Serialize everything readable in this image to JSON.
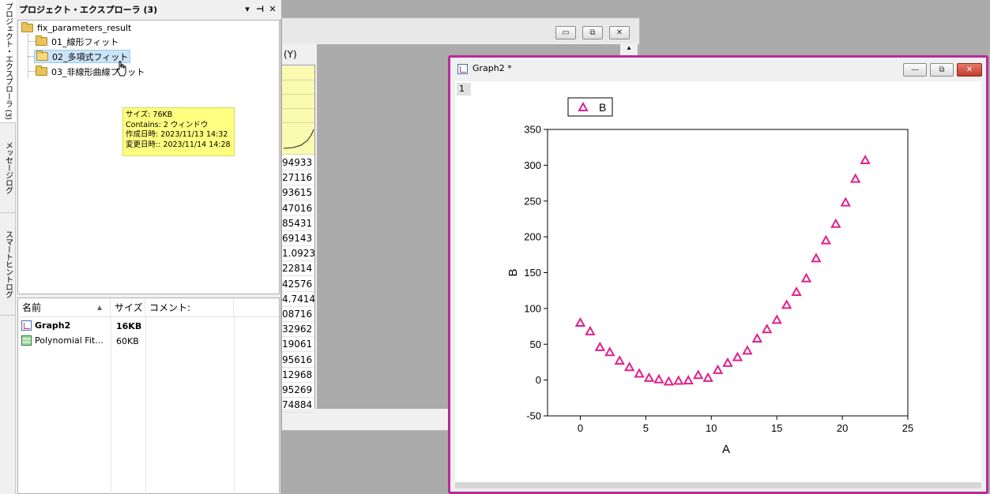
{
  "left_tabs": {
    "project_explorer": "プロジェクト・エクスプローラ (3)",
    "message_log": "メッセージログ",
    "smart_hint_log": "スマートヒントログ"
  },
  "project_explorer": {
    "title": "プロジェクト・エクスプローラ (3)",
    "title_buttons": {
      "dropdown": "▾",
      "pin": "⊣",
      "close": "✕"
    },
    "root": "fix_parameters_result",
    "folders": [
      {
        "label": "01_線形フィット"
      },
      {
        "label": "02_多項式フィット",
        "selected": true
      },
      {
        "label": "03_非線形曲線フィット"
      }
    ],
    "tooltip": {
      "size": "サイズ: 76KB",
      "contains": "Contains: 2 ウィンドウ",
      "created": "作成日時: 2023/11/13 14:32",
      "modified": "変更日時:: 2023/11/14 14:28"
    },
    "list": {
      "headers": {
        "name": "名前",
        "size": "サイズ",
        "comment": "コメント:"
      },
      "rows": [
        {
          "name": "Graph2",
          "size": "16KB",
          "icon": "graph-icon",
          "bold": true
        },
        {
          "name": "Polynomial Fit...",
          "size": "60KB",
          "icon": "workbook-icon",
          "bold": false
        }
      ]
    }
  },
  "workbook": {
    "column_header": "(Y)",
    "values": [
      "94933",
      "27116",
      "93615",
      "47016",
      "85431",
      "69143",
      "1.0923",
      "22814",
      "42576",
      "4.7414",
      "08716",
      "32962",
      "19061",
      "95616",
      "12968",
      "95269",
      "74884"
    ],
    "buttons": {
      "minimize": "▭",
      "restore": "⧉",
      "close": "✕"
    }
  },
  "graph_window": {
    "title": "Graph2 *",
    "layer": "1",
    "buttons": {
      "minimize": "—",
      "restore": "⧉",
      "close": "✕"
    },
    "accent": "#b82a9c"
  },
  "chart_data": {
    "type": "scatter",
    "xlabel": "A",
    "ylabel": "B",
    "xlim": [
      -2.5,
      25
    ],
    "ylim": [
      -50,
      350
    ],
    "xticks": [
      0,
      5,
      10,
      15,
      20,
      25
    ],
    "yticks": [
      -50,
      0,
      50,
      100,
      150,
      200,
      250,
      300,
      350
    ],
    "legend": "top-left",
    "marker": "open-triangle",
    "marker_color": "#e0208a",
    "series": [
      {
        "name": "B",
        "x": [
          0,
          0.75,
          1.5,
          2.25,
          3.0,
          3.75,
          4.5,
          5.25,
          6.0,
          6.75,
          7.5,
          8.25,
          9.0,
          9.75,
          10.5,
          11.25,
          12.0,
          12.75,
          13.5,
          14.25,
          15.0,
          15.75,
          16.5,
          17.25,
          18.0,
          18.75,
          19.5,
          20.25,
          21.0,
          21.75
        ],
        "y": [
          80,
          68,
          46,
          39,
          27,
          18,
          9,
          3,
          1,
          -2,
          -1,
          -0.5,
          7,
          3,
          14,
          24,
          32,
          41,
          58,
          71,
          84,
          105,
          123,
          142,
          170,
          195,
          218,
          248,
          281,
          307
        ]
      }
    ]
  }
}
